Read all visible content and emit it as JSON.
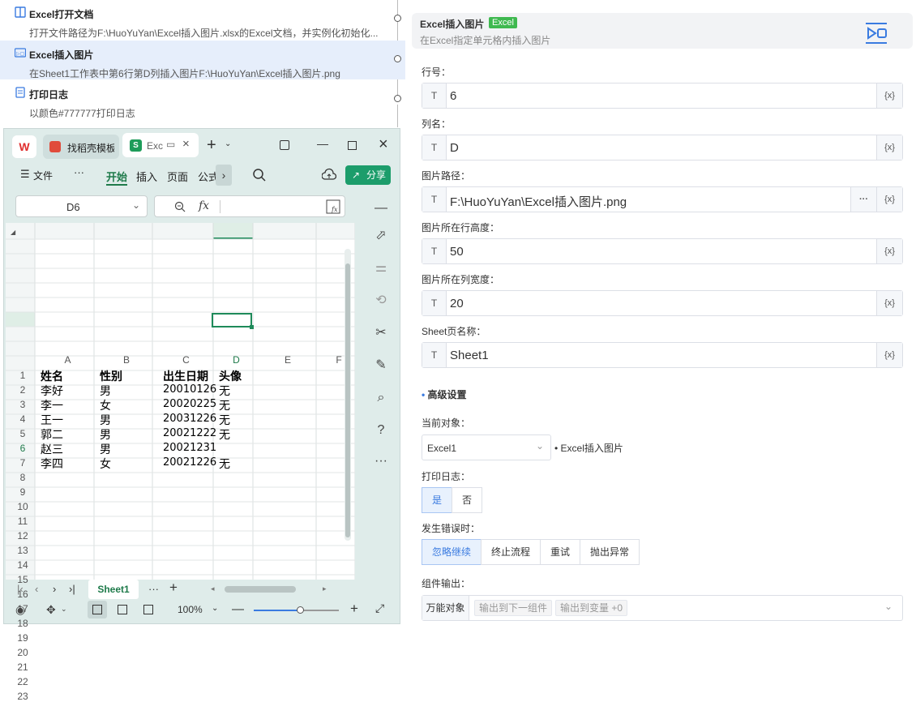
{
  "flow": {
    "steps": [
      {
        "title": "Excel打开文档",
        "desc": "打开文件路径为F:\\HuoYuYan\\Excel插入图片.xlsx的Excel文档，并实例化初始化...",
        "icon": "book-icon"
      },
      {
        "title": "Excel插入图片",
        "desc": "在Sheet1工作表中第6行第D列插入图片F:\\HuoYuYan\\Excel插入图片.png",
        "icon": "image-insert-icon"
      },
      {
        "title": "打印日志",
        "desc": "以颜色#777777打印日志",
        "icon": "log-icon"
      }
    ]
  },
  "excel": {
    "tabs": {
      "app_tab": "找稻壳模板",
      "doc_tab": "Excel"
    },
    "toolbar": {
      "file": "文件",
      "more": "···",
      "start": "开始",
      "insert": "插入",
      "page": "页面",
      "formula": "公式",
      "share": "分享"
    },
    "name_box": "D6",
    "fx": "fx",
    "columns": [
      "A",
      "B",
      "C",
      "D",
      "E",
      "F"
    ],
    "rows": [
      "1",
      "2",
      "3",
      "4",
      "5",
      "6",
      "7",
      "8",
      "9",
      "10",
      "11",
      "12",
      "13",
      "14",
      "15",
      "16",
      "17",
      "18",
      "19",
      "20",
      "21",
      "22",
      "23"
    ],
    "data": [
      [
        "姓名",
        "性别",
        "出生日期",
        "头像"
      ],
      [
        "李好",
        "男",
        "20010126",
        "无"
      ],
      [
        "李一",
        "女",
        "20020225",
        "无"
      ],
      [
        "王一",
        "男",
        "20031226",
        "无"
      ],
      [
        "郭二",
        "男",
        "20021222",
        "无"
      ],
      [
        "赵三",
        "男",
        "20021231",
        ""
      ],
      [
        "李四",
        "女",
        "20021226",
        "无"
      ]
    ],
    "sheet_tab": "Sheet1",
    "zoom": "100%",
    "zoom_level": 0.45
  },
  "panel": {
    "title": "Excel插入图片",
    "badge": "Excel",
    "subtitle": "在Excel指定单元格内插入图片",
    "fields": [
      {
        "label": "行号：",
        "value": "6"
      },
      {
        "label": "列名：",
        "value": "D"
      },
      {
        "label": "图片路径：",
        "value": "F:\\HuoYuYan\\Excel插入图片.png"
      },
      {
        "label": "图片所在行高度：",
        "value": "50"
      },
      {
        "label": "图片所在列宽度：",
        "value": "20"
      },
      {
        "label": "Sheet页名称：",
        "value": "Sheet1"
      }
    ],
    "type_tag": "T",
    "var_tag": "{x}",
    "more_tag": "···",
    "advanced": "高级设置",
    "current_obj_label": "当前对象：",
    "current_obj_value": "Excel1",
    "current_obj_hint": "• Excel插入图片",
    "print_log_label": "打印日志：",
    "print_yes": "是",
    "print_no": "否",
    "on_error_label": "发生错误时：",
    "on_error_options": [
      "忽略继续",
      "终止流程",
      "重试",
      "抛出异常"
    ],
    "output_label": "组件输出：",
    "output_type": "万能对象",
    "output_tag1": "输出到下一组件",
    "output_tag2": "输出到变量 +0",
    "accent": "#3a7be0",
    "badge_color": "#3fb950"
  }
}
